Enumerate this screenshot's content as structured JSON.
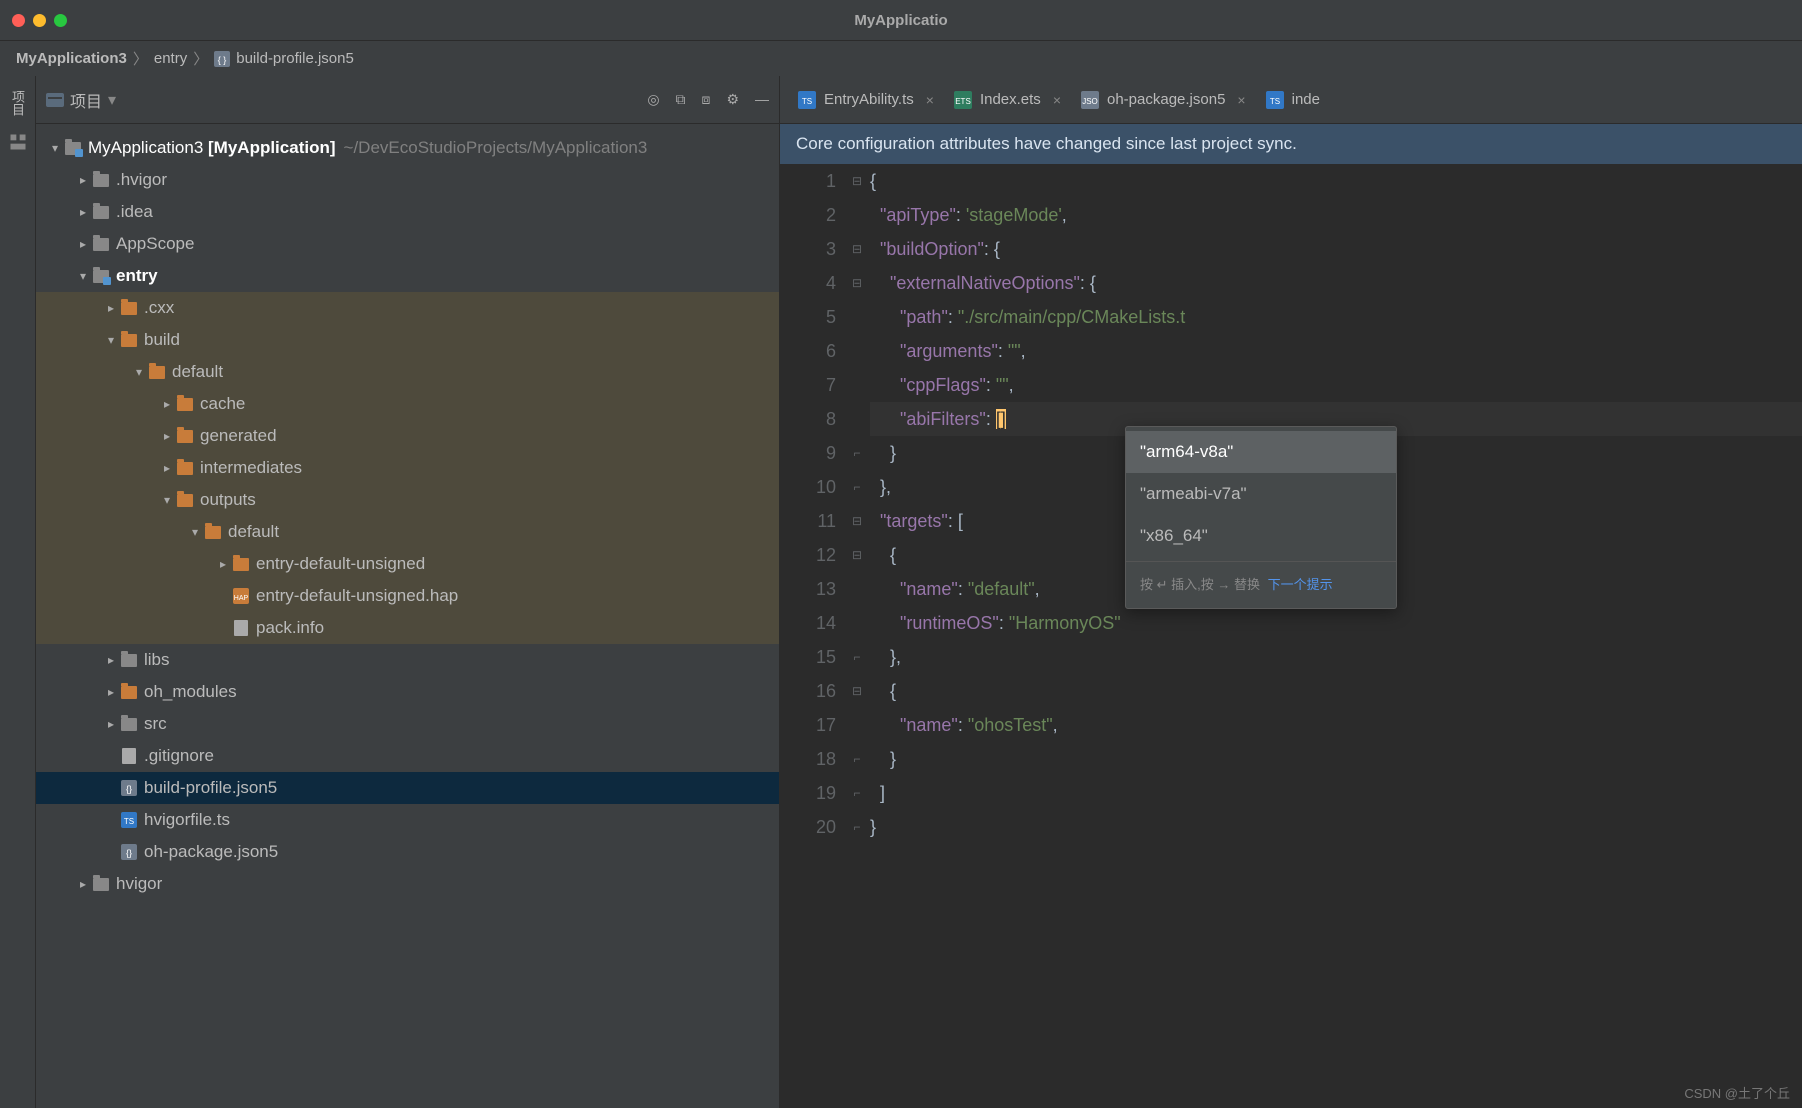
{
  "window_title": "MyApplicatio",
  "breadcrumb": [
    "MyApplication3",
    "entry",
    "build-profile.json5"
  ],
  "project_panel": {
    "title": "项目",
    "toolbar_icons": [
      "target-icon",
      "collapse-icon",
      "expand-icon",
      "settings-icon",
      "minimize-icon"
    ]
  },
  "tree": {
    "root": {
      "name": "MyApplication3",
      "bold": "[MyApplication]",
      "path": "~/DevEcoStudioProjects/MyApplication3"
    },
    "items": [
      {
        "d": 1,
        "exp": "closed",
        "type": "folder",
        "label": ".hvigor"
      },
      {
        "d": 1,
        "exp": "closed",
        "type": "folder",
        "label": ".idea"
      },
      {
        "d": 1,
        "exp": "closed",
        "type": "folder",
        "label": "AppScope"
      },
      {
        "d": 1,
        "exp": "open",
        "type": "folder-tag",
        "label": "entry",
        "bold": true
      },
      {
        "d": 2,
        "exp": "closed",
        "type": "folder-or",
        "label": ".cxx",
        "dk": true
      },
      {
        "d": 2,
        "exp": "open",
        "type": "folder-or",
        "label": "build",
        "dk": true
      },
      {
        "d": 3,
        "exp": "open",
        "type": "folder-or",
        "label": "default",
        "dk": true
      },
      {
        "d": 4,
        "exp": "closed",
        "type": "folder-or",
        "label": "cache",
        "dk": true
      },
      {
        "d": 4,
        "exp": "closed",
        "type": "folder-or",
        "label": "generated",
        "dk": true
      },
      {
        "d": 4,
        "exp": "closed",
        "type": "folder-or",
        "label": "intermediates",
        "dk": true
      },
      {
        "d": 4,
        "exp": "open",
        "type": "folder-or",
        "label": "outputs",
        "dk": true
      },
      {
        "d": 5,
        "exp": "open",
        "type": "folder-or",
        "label": "default",
        "dk": true
      },
      {
        "d": 6,
        "exp": "closed",
        "type": "folder-or",
        "label": "entry-default-unsigned",
        "dk": true
      },
      {
        "d": 6,
        "exp": "none",
        "type": "file-hap",
        "label": "entry-default-unsigned.hap",
        "dk": true
      },
      {
        "d": 6,
        "exp": "none",
        "type": "file",
        "label": "pack.info",
        "dk": true
      },
      {
        "d": 2,
        "exp": "closed",
        "type": "folder",
        "label": "libs"
      },
      {
        "d": 2,
        "exp": "closed",
        "type": "folder-or",
        "label": "oh_modules"
      },
      {
        "d": 2,
        "exp": "closed",
        "type": "folder",
        "label": "src"
      },
      {
        "d": 2,
        "exp": "none",
        "type": "file",
        "label": ".gitignore"
      },
      {
        "d": 2,
        "exp": "none",
        "type": "file-json",
        "label": "build-profile.json5",
        "sel": true
      },
      {
        "d": 2,
        "exp": "none",
        "type": "file-ts",
        "label": "hvigorfile.ts"
      },
      {
        "d": 2,
        "exp": "none",
        "type": "file-json",
        "label": "oh-package.json5"
      },
      {
        "d": 1,
        "exp": "closed",
        "type": "folder",
        "label": "hvigor"
      }
    ]
  },
  "tabs": [
    {
      "label": "EntryAbility.ts",
      "icon": "ts"
    },
    {
      "label": "Index.ets",
      "icon": "ets"
    },
    {
      "label": "oh-package.json5",
      "icon": "json"
    },
    {
      "label": "inde",
      "icon": "ts",
      "noclose": true
    }
  ],
  "banner": "Core configuration attributes have changed since last project sync.",
  "code_lines": [
    {
      "n": 1,
      "html": "{"
    },
    {
      "n": 2,
      "html": "  <span class='p'>\"apiType\"</span>: <span class='s'>'stageMode'</span>,"
    },
    {
      "n": 3,
      "html": "  <span class='p'>\"buildOption\"</span>: {"
    },
    {
      "n": 4,
      "html": "    <span class='p'>\"externalNativeOptions\"</span>: {"
    },
    {
      "n": 5,
      "html": "      <span class='p'>\"path\"</span>: <span class='s'>\"./src/main/cpp/CMakeLists.t</span>"
    },
    {
      "n": 6,
      "html": "      <span class='p'>\"arguments\"</span>: <span class='s'>\"\"</span>,"
    },
    {
      "n": 7,
      "html": "      <span class='p'>\"cppFlags\"</span>: <span class='s'>\"\"</span>,"
    },
    {
      "n": 8,
      "html": "      <span class='p'>\"abiFilters\"</span>: <span class='cur'>[</span><span class='cur'>]</span>",
      "hl": true
    },
    {
      "n": 9,
      "html": "    }"
    },
    {
      "n": 10,
      "html": "  },"
    },
    {
      "n": 11,
      "html": "  <span class='p'>\"targets\"</span>: ["
    },
    {
      "n": 12,
      "html": "    {"
    },
    {
      "n": 13,
      "html": "      <span class='p'>\"name\"</span>: <span class='s'>\"default\"</span>,"
    },
    {
      "n": 14,
      "html": "      <span class='p'>\"runtimeOS\"</span>: <span class='s'>\"HarmonyOS\"</span>"
    },
    {
      "n": 15,
      "html": "    },"
    },
    {
      "n": 16,
      "html": "    {"
    },
    {
      "n": 17,
      "html": "      <span class='p'>\"name\"</span>: <span class='s'>\"ohosTest\"</span>,"
    },
    {
      "n": 18,
      "html": "    }"
    },
    {
      "n": 19,
      "html": "  ]"
    },
    {
      "n": 20,
      "html": "}"
    }
  ],
  "popup": {
    "options": [
      "\"arm64-v8a\"",
      "\"armeabi-v7a\"",
      "\"x86_64\""
    ],
    "hint": "按 ↵ 插入,按 → 替换",
    "hint_link": "下一个提示"
  },
  "watermark": "CSDN @土了个丘"
}
